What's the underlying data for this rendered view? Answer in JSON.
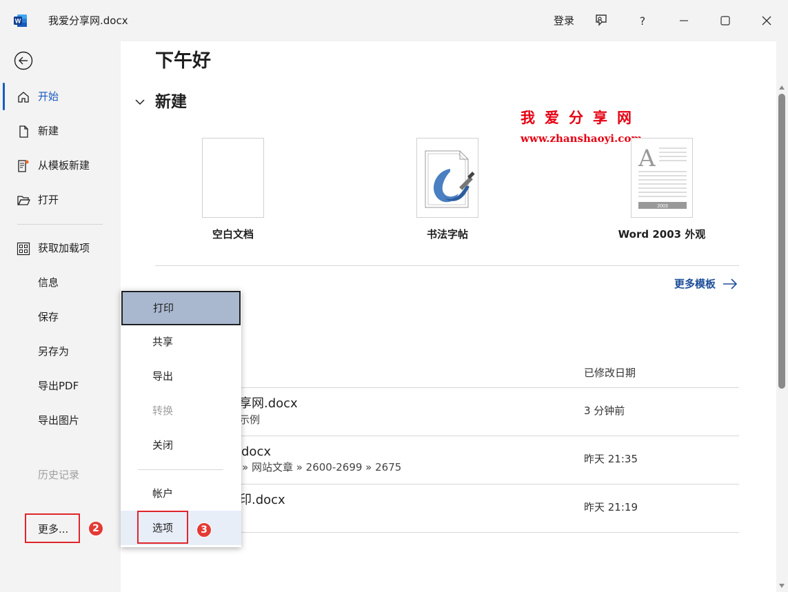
{
  "app": {
    "doc_title": "我爱分享网.docx",
    "login": "登录",
    "help": "?"
  },
  "nav": {
    "items": [
      {
        "label": "开始",
        "icon": "home-icon"
      },
      {
        "label": "新建",
        "icon": "new-doc-icon"
      },
      {
        "label": "从模板新建",
        "icon": "template-icon"
      },
      {
        "label": "打开",
        "icon": "folder-open-icon"
      },
      {
        "label": "获取加载项",
        "icon": "addins-grid-icon"
      },
      {
        "label": "信息"
      },
      {
        "label": "保存"
      },
      {
        "label": "另存为"
      },
      {
        "label": "导出PDF"
      },
      {
        "label": "导出图片"
      },
      {
        "label": "历史记录"
      }
    ],
    "more": "更多...",
    "badge_more": "2"
  },
  "main": {
    "greeting": "下午好",
    "new_section": "新建",
    "templates": [
      {
        "label": "空白文档"
      },
      {
        "label": "书法字帖"
      },
      {
        "label": "Word 2003 外观",
        "thumb_text": "2003"
      }
    ],
    "more_templates": "更多模板",
    "recent_partial": "",
    "col_date": "已修改日期",
    "rows": [
      {
        "name": "享网.docx",
        "path": "示例",
        "date": "3 分钟前"
      },
      {
        "name": "docx",
        "path": "» 网站文章 » 2600-2699 » 2675",
        "date": "昨天 21:35"
      },
      {
        "name": "印.docx",
        "path": "",
        "date": "昨天 21:19"
      }
    ],
    "watermark_cn": "我爱分享网",
    "watermark_url": "www.zhanshaoyi.com"
  },
  "popup": {
    "items": [
      "打印",
      "共享",
      "导出",
      "转换",
      "关闭",
      "帐户",
      "选项"
    ],
    "badge_options": "3"
  },
  "colors": {
    "accent": "#185abd",
    "highlight_box": "#e0242b",
    "selected_menu": "#a9b8cf"
  }
}
